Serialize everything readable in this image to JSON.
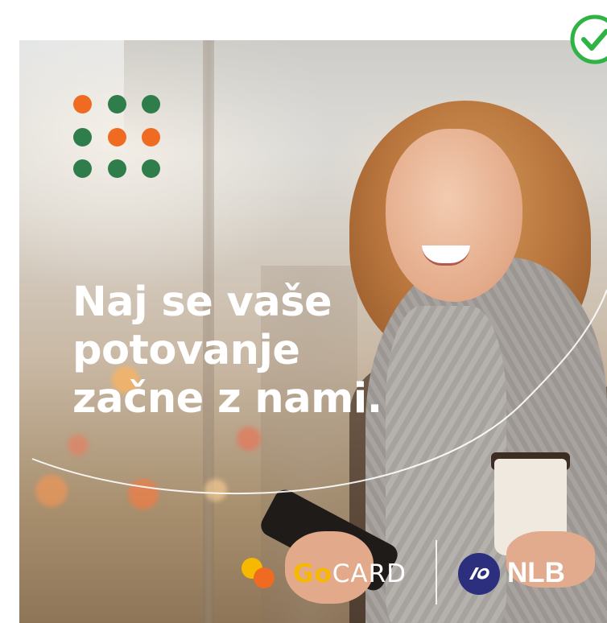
{
  "headline": {
    "line1": "Naj se vaše",
    "line2": "potovanje",
    "line3": "začne z nami."
  },
  "brand_dots": {
    "grid": [
      [
        "orange",
        "green",
        "green"
      ],
      [
        "green",
        "orange",
        "orange"
      ],
      [
        "green",
        "green",
        "green"
      ]
    ],
    "colors": {
      "orange": "#ef6b21",
      "green": "#2e7d4a"
    }
  },
  "gocard": {
    "go": "Go",
    "card": "CARD",
    "go_color": "#f7b800"
  },
  "nlb": {
    "label": "NLB",
    "badge_color": "#2b2f7e"
  },
  "status": {
    "icon": "check-circle-icon",
    "color": "#2fb344"
  }
}
